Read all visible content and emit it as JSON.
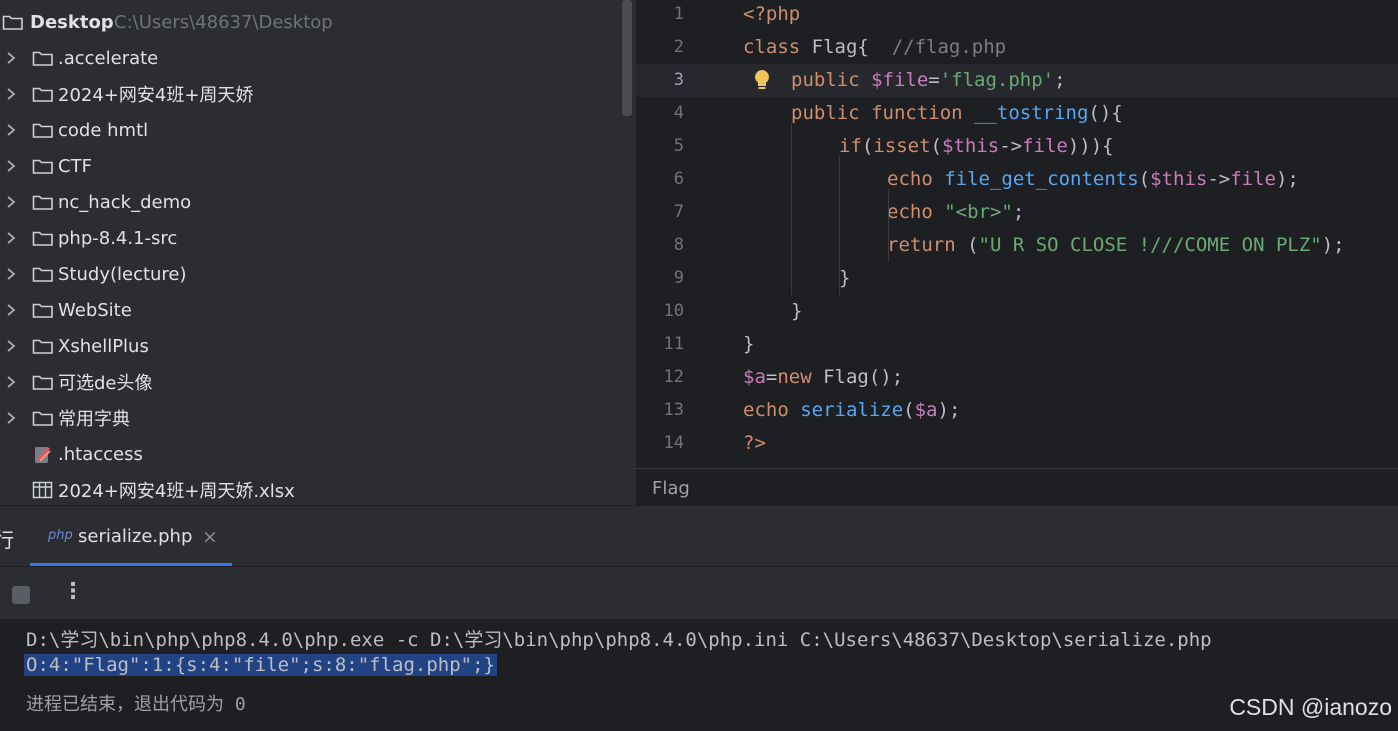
{
  "project": {
    "root_label": "Desktop",
    "root_path": "C:\\Users\\48637\\Desktop",
    "items": [
      {
        "label": ".accelerate",
        "type": "folder"
      },
      {
        "label": "2024+网安4班+周天娇",
        "type": "folder"
      },
      {
        "label": "code hmtl",
        "type": "folder"
      },
      {
        "label": "CTF",
        "type": "folder"
      },
      {
        "label": "nc_hack_demo",
        "type": "folder"
      },
      {
        "label": "php-8.4.1-src",
        "type": "folder"
      },
      {
        "label": "Study(lecture)",
        "type": "folder"
      },
      {
        "label": "WebSite",
        "type": "folder"
      },
      {
        "label": "XshellPlus",
        "type": "folder"
      },
      {
        "label": "可选de头像",
        "type": "folder"
      },
      {
        "label": "常用字典",
        "type": "folder"
      },
      {
        "label": ".htaccess",
        "type": "file-htaccess"
      },
      {
        "label": "2024+网安4班+周天娇.xlsx",
        "type": "file-table"
      }
    ]
  },
  "editor": {
    "current_line": 3,
    "line_numbers": [
      "1",
      "2",
      "3",
      "4",
      "5",
      "6",
      "7",
      "8",
      "9",
      "10",
      "11",
      "12",
      "13",
      "14"
    ],
    "lines": [
      [
        [
          "kw",
          "<?php"
        ]
      ],
      [
        [
          "kw",
          "class "
        ],
        [
          "def",
          "Flag{  "
        ],
        [
          "cmt",
          "//flag.php"
        ]
      ],
      [
        [
          "kw",
          "public "
        ],
        [
          "var",
          "$file"
        ],
        [
          "def",
          "="
        ],
        [
          "str",
          "'flag.php'"
        ],
        [
          "def",
          ";"
        ]
      ],
      [
        [
          "kw",
          "public function "
        ],
        [
          "fn",
          "__tostring"
        ],
        [
          "def",
          "(){"
        ]
      ],
      [
        [
          "kw",
          "if"
        ],
        [
          "def",
          "("
        ],
        [
          "kw",
          "isset"
        ],
        [
          "def",
          "("
        ],
        [
          "var",
          "$this"
        ],
        [
          "def",
          "->"
        ],
        [
          "var",
          "file"
        ],
        [
          "def",
          "))){"
        ]
      ],
      [
        [
          "kw",
          "echo "
        ],
        [
          "fn",
          "file_get_contents"
        ],
        [
          "def",
          "("
        ],
        [
          "var",
          "$this"
        ],
        [
          "def",
          "->"
        ],
        [
          "var",
          "file"
        ],
        [
          "def",
          ");"
        ]
      ],
      [
        [
          "kw",
          "echo "
        ],
        [
          "str",
          "\"<br>\""
        ],
        [
          "def",
          ";"
        ]
      ],
      [
        [
          "kw",
          "return "
        ],
        [
          "def",
          "("
        ],
        [
          "str",
          "\"U R SO CLOSE !///COME ON PLZ\""
        ],
        [
          "def",
          ");"
        ]
      ],
      [
        [
          "def",
          "}"
        ]
      ],
      [
        [
          "def",
          "}"
        ]
      ],
      [
        [
          "def",
          "}"
        ]
      ],
      [
        [
          "var",
          "$a"
        ],
        [
          "def",
          "="
        ],
        [
          "kw",
          "new "
        ],
        [
          "def",
          "Flag();"
        ]
      ],
      [
        [
          "kw",
          "echo "
        ],
        [
          "fn",
          "serialize"
        ],
        [
          "def",
          "("
        ],
        [
          "var",
          "$a"
        ],
        [
          "def",
          ");"
        ]
      ],
      [
        [
          "kw",
          "?>"
        ]
      ]
    ],
    "indent": [
      0,
      0,
      1,
      1,
      2,
      3,
      3,
      3,
      2,
      1,
      0,
      0,
      0,
      0
    ],
    "breadcrumb": "Flag"
  },
  "run": {
    "side_label": "行",
    "tab_icon_text": "php",
    "tab_label": "serialize.php",
    "tab_close": "×",
    "more_icon": "⋮",
    "console": {
      "command": "D:\\学习\\bin\\php\\php8.4.0\\php.exe -c D:\\学习\\bin\\php\\php8.4.0\\php.ini C:\\Users\\48637\\Desktop\\serialize.php",
      "output": "O:4:\"Flag\":1:{s:4:\"file\";s:8:\"flag.php\";}",
      "exit": "进程已结束，退出代码为 0"
    }
  },
  "watermark": "CSDN @ianozo",
  "colors": {
    "keyword": "#cf8e6d",
    "variable": "#c77dbb",
    "string": "#6aab73",
    "comment": "#7a7e85",
    "function": "#56a8f5",
    "selection": "#214283",
    "tab_underline": "#3574f0"
  }
}
